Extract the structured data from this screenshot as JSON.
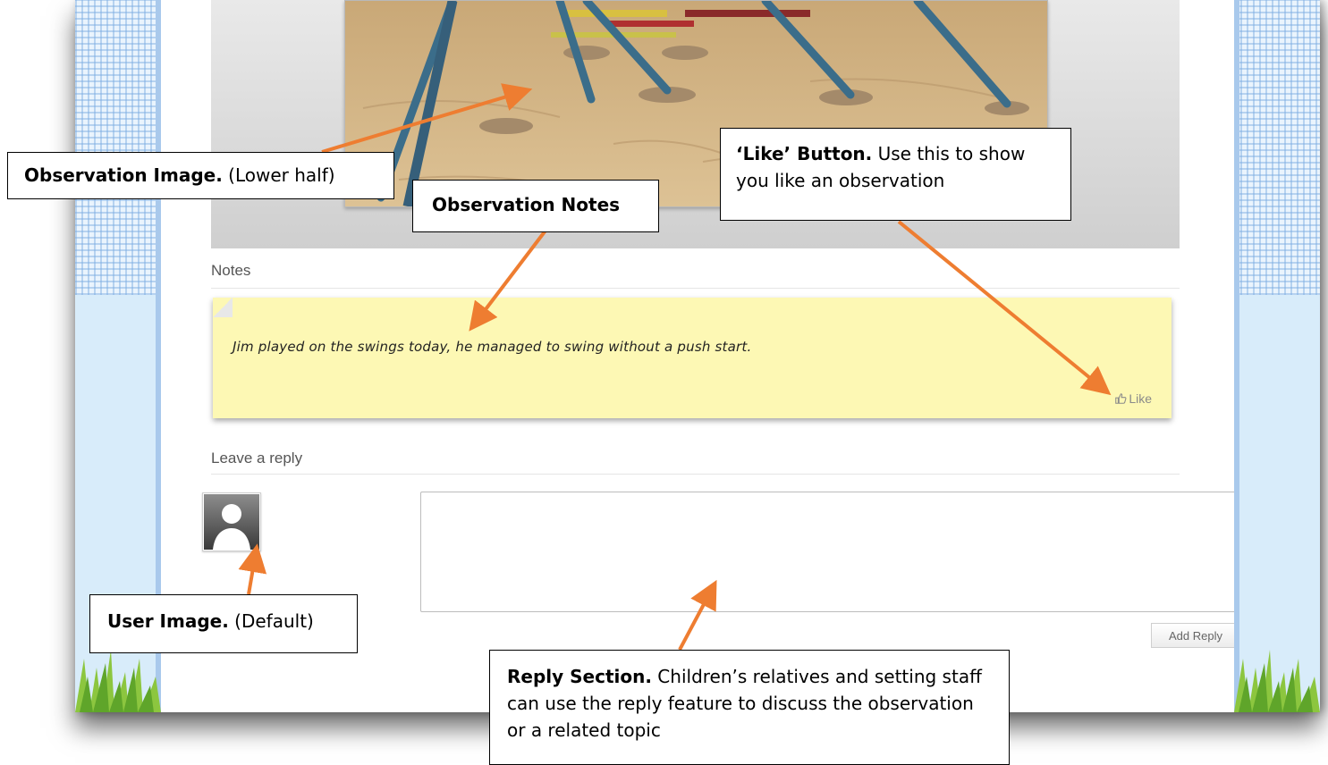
{
  "notes_section": {
    "heading": "Notes"
  },
  "note": {
    "text": "Jim played on the swings today, he managed to swing without a push start.",
    "like_label": "Like"
  },
  "reply_section": {
    "heading": "Leave a reply",
    "textarea_value": "",
    "add_reply_label": "Add Reply"
  },
  "annotations": {
    "observation_image": {
      "title": "Observation Image.",
      "detail": " (Lower half)"
    },
    "observation_notes": {
      "title": "Observation Notes"
    },
    "like_button": {
      "title": "‘Like’ Button.",
      "detail": " Use this to show you like an observation"
    },
    "user_image": {
      "title": "User Image.",
      "detail": " (Default)"
    },
    "reply_section": {
      "title": "Reply Section.",
      "detail": " Children’s relatives and setting staff can use the reply feature to discuss the observation or a related topic"
    }
  },
  "colors": {
    "arrow": "#ee7d31",
    "note_bg": "#fdf8b4",
    "side_blue": "#dcefff"
  },
  "icons": [
    "thumbs-up-icon",
    "default-user-icon",
    "resize-grip-icon"
  ]
}
